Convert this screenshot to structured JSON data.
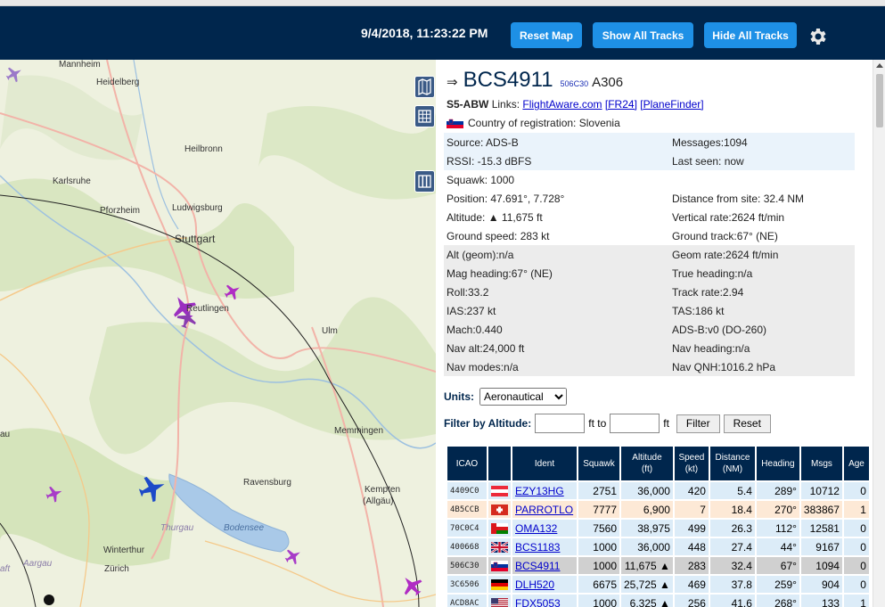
{
  "header": {
    "clock": "9/4/2018, 11:23:22 PM",
    "reset_map": "Reset Map",
    "show_all_tracks": "Show All Tracks",
    "hide_all_tracks": "Hide All Tracks",
    "settings_icon": "gear-icon",
    "bg_color": "#00264d",
    "button_color": "#1e90e6"
  },
  "map": {
    "cities": [
      "Mannheim",
      "Heidelberg",
      "Heilbronn",
      "Karlsruhe",
      "Pforzheim",
      "Ludwigsburg",
      "Stuttgart",
      "Reutlingen",
      "Ulm",
      "Memmingen",
      "Ravensburg",
      "Kempten",
      "(Allgäu)",
      "Thurgau",
      "Bodensee",
      "Winterthur",
      "Zürich",
      "Aargau",
      "au",
      "aft"
    ],
    "controls": [
      "map-layers-icon",
      "grid-icon",
      "columns-icon"
    ]
  },
  "detail": {
    "arrow": "⇒",
    "callsign": "BCS4911",
    "hex": "506C30",
    "type": "A306",
    "registration": "S5-ABW",
    "links_label": "Links:",
    "link_flightaware": "FlightAware.com",
    "link_fr24": "[FR24]",
    "link_planefinder": "[PlaneFinder]",
    "country": "Country of registration: Slovenia",
    "rows": [
      [
        "Source: ADS-B",
        "Messages:1094"
      ],
      [
        "RSSI: -15.3 dBFS",
        "Last seen: now"
      ],
      [
        "Squawk: 1000",
        ""
      ],
      [
        "Position: 47.691°, 7.728°",
        "Distance from site: 32.4 NM"
      ],
      [
        "Altitude: ▲ 11,675 ft",
        "Vertical rate:2624 ft/min"
      ],
      [
        "Ground speed: 283 kt",
        "Ground track:67° (NE)"
      ],
      [
        "Alt (geom):n/a",
        "Geom rate:2624 ft/min"
      ],
      [
        "Mag heading:67° (NE)",
        "True heading:n/a"
      ],
      [
        "Roll:33.2",
        "Track rate:2.94"
      ],
      [
        "IAS:237 kt",
        "TAS:186 kt"
      ],
      [
        "Mach:0.440",
        "ADS-B:v0 (DO-260)"
      ],
      [
        "Nav alt:24,000 ft",
        "Nav heading:n/a"
      ],
      [
        "Nav modes:n/a",
        "Nav QNH:1016.2 hPa"
      ]
    ]
  },
  "units": {
    "label": "Units:",
    "selected": "Aeronautical"
  },
  "filter": {
    "label": "Filter by Altitude:",
    "ft_to": "ft to",
    "ft": "ft",
    "filter_btn": "Filter",
    "reset_btn": "Reset"
  },
  "table": {
    "headers": [
      "ICAO",
      "",
      "Ident",
      "Squawk",
      "Altitude\n(ft)",
      "Speed\n(kt)",
      "Distance\n(NM)",
      "Heading",
      "Msgs",
      "Age"
    ],
    "rows": [
      [
        "4409C0",
        "AT",
        "EZY13HG",
        "2751",
        "36,000",
        "420",
        "5.4",
        "289°",
        "10712",
        "0"
      ],
      [
        "4B5CCB",
        "CH",
        "PARROTLO",
        "7777",
        "6,900",
        "7",
        "18.4",
        "270°",
        "383867",
        "1"
      ],
      [
        "70C0C4",
        "OM",
        "OMA132",
        "7560",
        "38,975",
        "499",
        "26.3",
        "112°",
        "12581",
        "0"
      ],
      [
        "400668",
        "GB",
        "BCS1183",
        "1000",
        "36,000",
        "448",
        "27.4",
        "44°",
        "9167",
        "0"
      ],
      [
        "506C30",
        "SI",
        "BCS4911",
        "1000",
        "11,675 ▲",
        "283",
        "32.4",
        "67°",
        "1094",
        "0"
      ],
      [
        "3C6506",
        "DE",
        "DLH520",
        "6675",
        "25,725 ▲",
        "469",
        "37.8",
        "259°",
        "904",
        "0"
      ],
      [
        "ACD8AC",
        "US",
        "FDX5053",
        "1000",
        "6,325 ▲",
        "256",
        "41.6",
        "268°",
        "133",
        "1"
      ]
    ]
  }
}
